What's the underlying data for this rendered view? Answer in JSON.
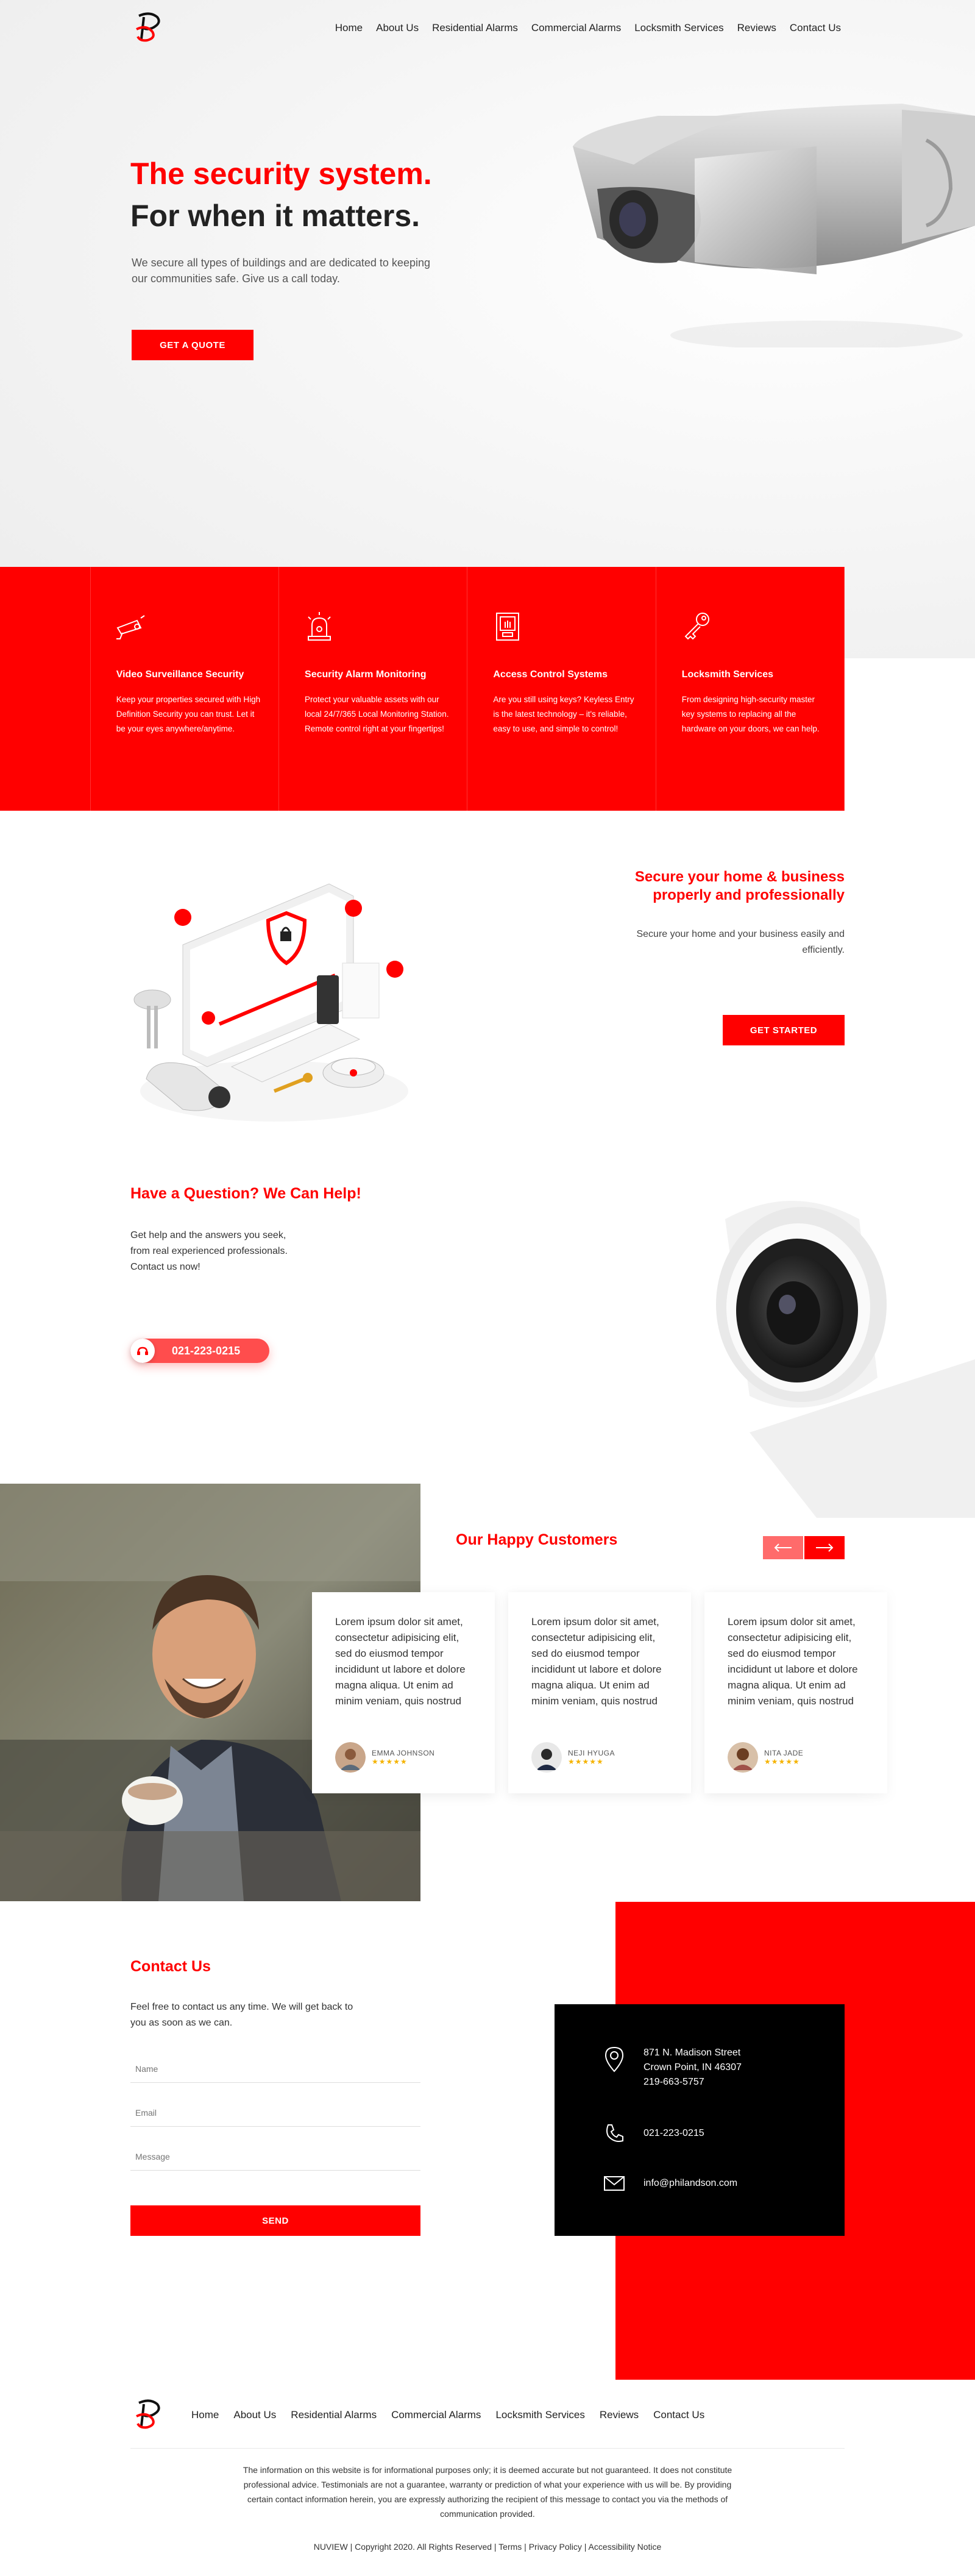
{
  "header": {
    "nav": [
      "Home",
      "About Us",
      "Residential Alarms",
      "Commercial Alarms",
      "Locksmith Services",
      "Reviews",
      "Contact Us"
    ]
  },
  "hero": {
    "headline_red": "The security system.",
    "headline_dark": "For when it matters.",
    "text": "We secure all types of buildings and are dedicated to keeping our communities safe. Give us a call today.",
    "cta": "GET A QUOTE"
  },
  "services": [
    {
      "icon": "camera-icon",
      "title": "Video Surveillance Security",
      "text": "Keep your properties secured with High Definition Security you can trust. Let it be your eyes anywhere/anytime."
    },
    {
      "icon": "alarm-icon",
      "title": "Security Alarm Monitoring",
      "text": "Protect your valuable assets with our local 24/7/365 Local Monitoring Station. Remote control right at your fingertips!"
    },
    {
      "icon": "access-icon",
      "title": "Access Control Systems",
      "text": "Are you still using keys? Keyless Entry is the latest technology – it's reliable, easy to use, and simple to control!"
    },
    {
      "icon": "key-icon",
      "title": "Locksmith Services",
      "text": "From designing high-security master key systems to replacing all the hardware on your doors, we can help."
    }
  ],
  "secure": {
    "title": "Secure your home & business properly and professionally",
    "text": "Secure your home and your business easily and efficiently.",
    "cta": "GET STARTED"
  },
  "question": {
    "title": "Have a Question? We Can Help!",
    "text": "Get help and the answers you seek, from real experienced professionals. Contact us now!",
    "phone": "021-223-0215"
  },
  "customers": {
    "title": "Our Happy Customers",
    "testimonials": [
      {
        "text": "Lorem ipsum dolor sit amet, consectetur adipisicing elit, sed do eiusmod tempor incididunt ut labore et dolore magna aliqua. Ut enim ad minim veniam, quis nostrud",
        "name": "EMMA JOHNSON",
        "stars": "★★★★★"
      },
      {
        "text": "Lorem ipsum dolor sit amet, consectetur adipisicing elit, sed do eiusmod tempor incididunt ut labore et dolore magna aliqua. Ut enim ad minim veniam, quis nostrud",
        "name": "NEJI HYUGA",
        "stars": "★★★★★"
      },
      {
        "text": "Lorem ipsum dolor sit amet, consectetur adipisicing elit, sed do eiusmod tempor incididunt ut labore et dolore magna aliqua. Ut enim ad minim veniam, quis nostrud",
        "name": "NITA JADE",
        "stars": "★★★★★"
      }
    ]
  },
  "contact": {
    "title": "Contact Us",
    "text": "Feel free to contact us any time. We will get back to you as soon as we can.",
    "name_placeholder": "Name",
    "email_placeholder": "Email",
    "message_placeholder": "Message",
    "send": "SEND",
    "address_line1": "871 N. Madison Street",
    "address_line2": "Crown Point, IN 46307",
    "address_phone": "219-663-5757",
    "phone": "021-223-0215",
    "email": "info@philandson.com"
  },
  "footer": {
    "nav": [
      "Home",
      "About Us",
      "Residential Alarms",
      "Commercial Alarms",
      "Locksmith Services",
      "Reviews",
      "Contact Us"
    ],
    "disclaimer": "The information on this website is for informational purposes only; it is deemed accurate but not guaranteed. It does not constitute professional advice. Testimonials are not a guarantee, warranty or prediction of what your experience with us will be. By providing certain contact information herein, you are expressly authorizing the recipient of this message to contact you via the methods of communication provided.",
    "copyright": "NUVIEW | Copyright 2020. All Rights Reserved | Terms | Privacy Policy | Accessibility Notice"
  },
  "colors": {
    "accent": "#ff0000",
    "dark": "#000000"
  }
}
